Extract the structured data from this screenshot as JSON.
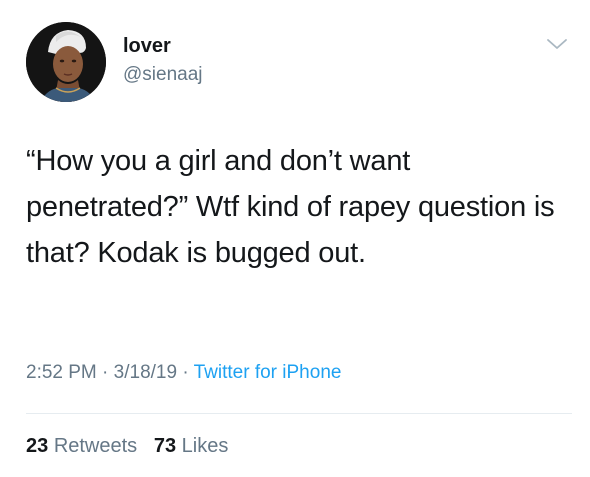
{
  "user": {
    "display_name": "lover",
    "handle": "@sienaaj"
  },
  "tweet": {
    "text": "“How you a girl and don’t want penetrated?” Wtf kind of rapey question is that? Kodak is bugged out.",
    "time": "2:52 PM",
    "separator": "·",
    "date": "3/18/19",
    "source": "Twitter for iPhone"
  },
  "stats": {
    "retweets_count": "23",
    "retweets_label": "Retweets",
    "likes_count": "73",
    "likes_label": "Likes"
  },
  "icons": {
    "menu": "chevron-down-icon"
  },
  "colors": {
    "text": "#14171a",
    "secondary": "#657786",
    "link": "#1da1f2",
    "divider": "#e6ecf0"
  }
}
